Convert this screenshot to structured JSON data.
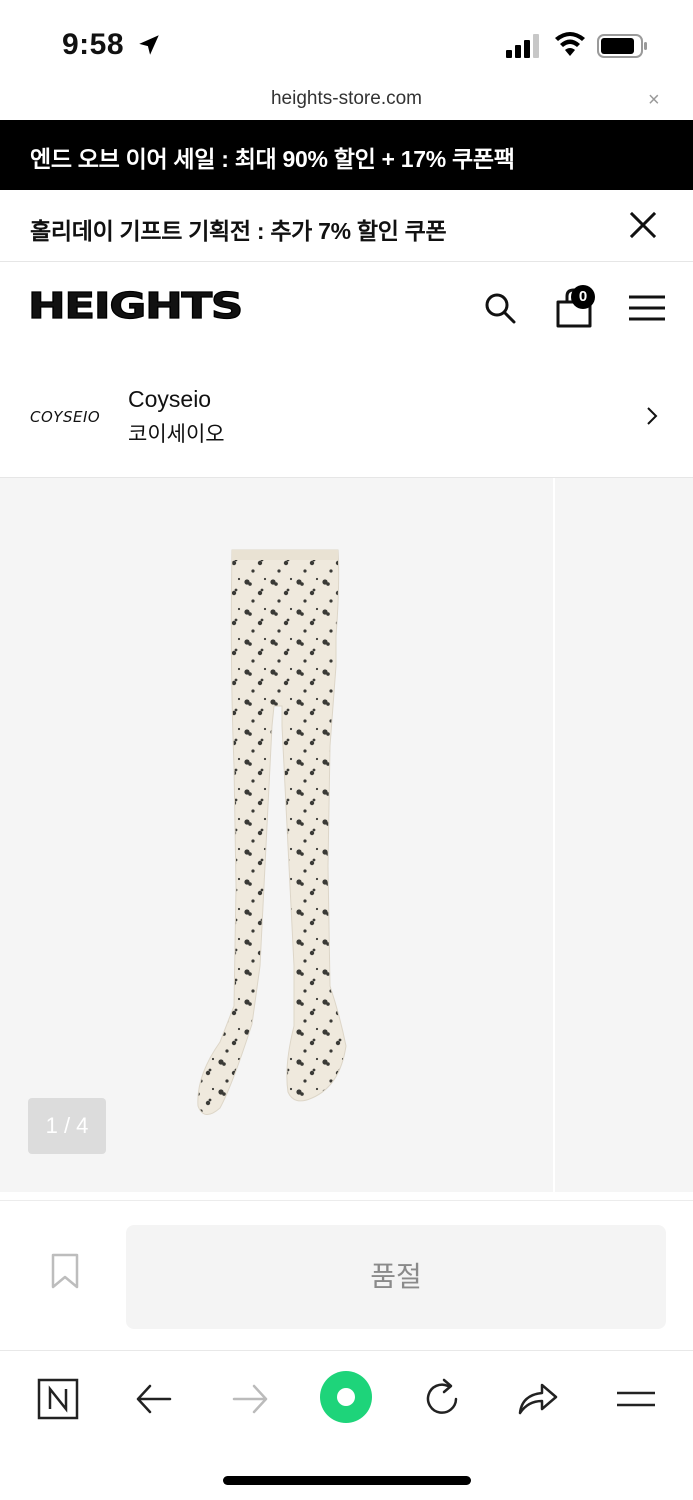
{
  "status_bar": {
    "time": "9:58"
  },
  "browser": {
    "url": "heights-store.com",
    "close_symbol": "×"
  },
  "promos": {
    "sale_banner": "엔드 오브 이어 세일 : 최대 90% 할인 + 17% 쿠폰팩",
    "holiday_banner": "홀리데이 기프트 기획전 : 추가 7% 할인 쿠폰"
  },
  "header": {
    "logo": "HEIGHTS",
    "cart_count": "0"
  },
  "brand": {
    "logo_text": "COYSEIO",
    "name_en": "Coyseio",
    "name_ko": "코이세이오"
  },
  "gallery": {
    "counter": "1 / 4"
  },
  "purchase": {
    "status_label": "품절"
  },
  "icons": {
    "location": "location-arrow-icon",
    "signal": "cellular-signal-icon",
    "wifi": "wifi-icon",
    "battery": "battery-icon",
    "close": "close-icon",
    "search": "search-icon",
    "cart": "shopping-bag-icon",
    "menu": "hamburger-menu-icon",
    "chevron": "chevron-right-icon",
    "bookmark": "bookmark-icon",
    "naver": "naver-home-icon",
    "back": "back-arrow-icon",
    "forward": "forward-arrow-icon",
    "green_dot": "green-record-icon",
    "reload": "reload-icon",
    "share": "share-icon",
    "browser_menu": "browser-menu-icon"
  },
  "colors": {
    "accent_green": "#1ED47A",
    "banner_black": "#000000",
    "soldout_text": "#8A8A8A"
  }
}
